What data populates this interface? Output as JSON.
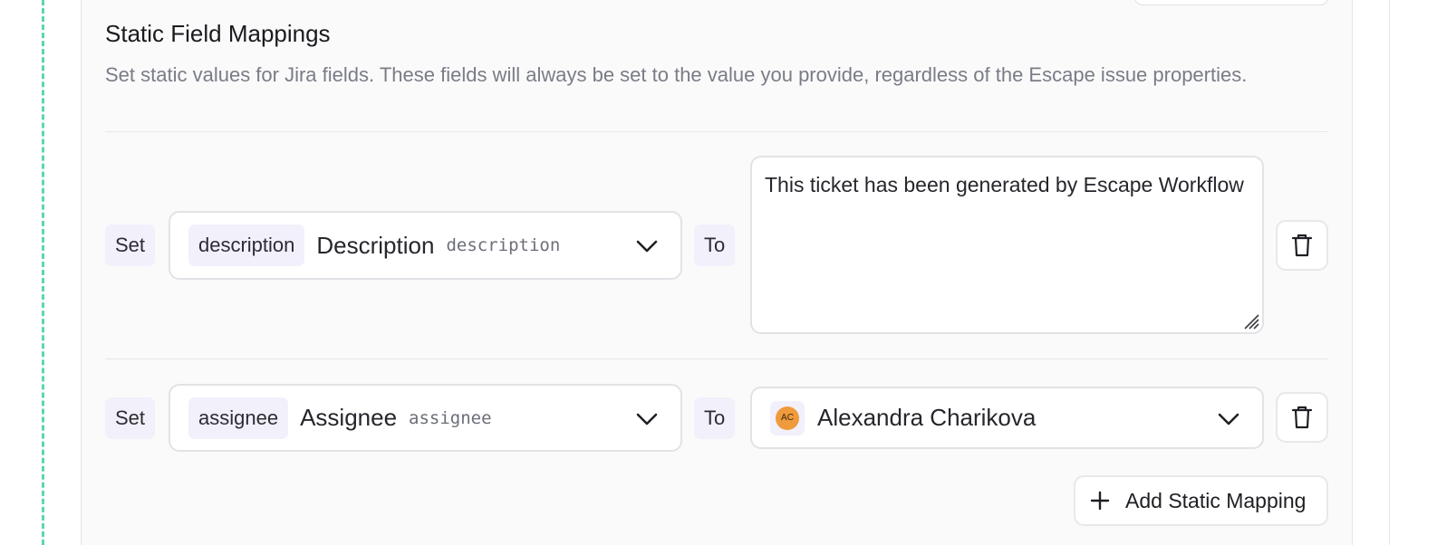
{
  "section": {
    "title": "Static Field Mappings",
    "description": "Set static values for Jira fields. These fields will always be set to the value you provide, regardless of the Escape issue properties."
  },
  "mappings": [
    {
      "set_label": "Set",
      "field_chip": "description",
      "field_name": "Description",
      "field_key": "description",
      "to_label": "To",
      "value": "This ticket has been generated by Escape Workflow"
    },
    {
      "set_label": "Set",
      "field_chip": "assignee",
      "field_name": "Assignee",
      "field_key": "assignee",
      "to_label": "To",
      "value_user": {
        "initials": "AC",
        "name": "Alexandra Charikova",
        "avatar_color": "#ef9a3c"
      }
    }
  ],
  "add_button": {
    "label": "Add Static Mapping",
    "icon": "plus-icon"
  },
  "colors": {
    "accent_dash": "#5fd6a8",
    "tag_bg": "#f2f0fb",
    "muted_text": "#7a7c86"
  }
}
